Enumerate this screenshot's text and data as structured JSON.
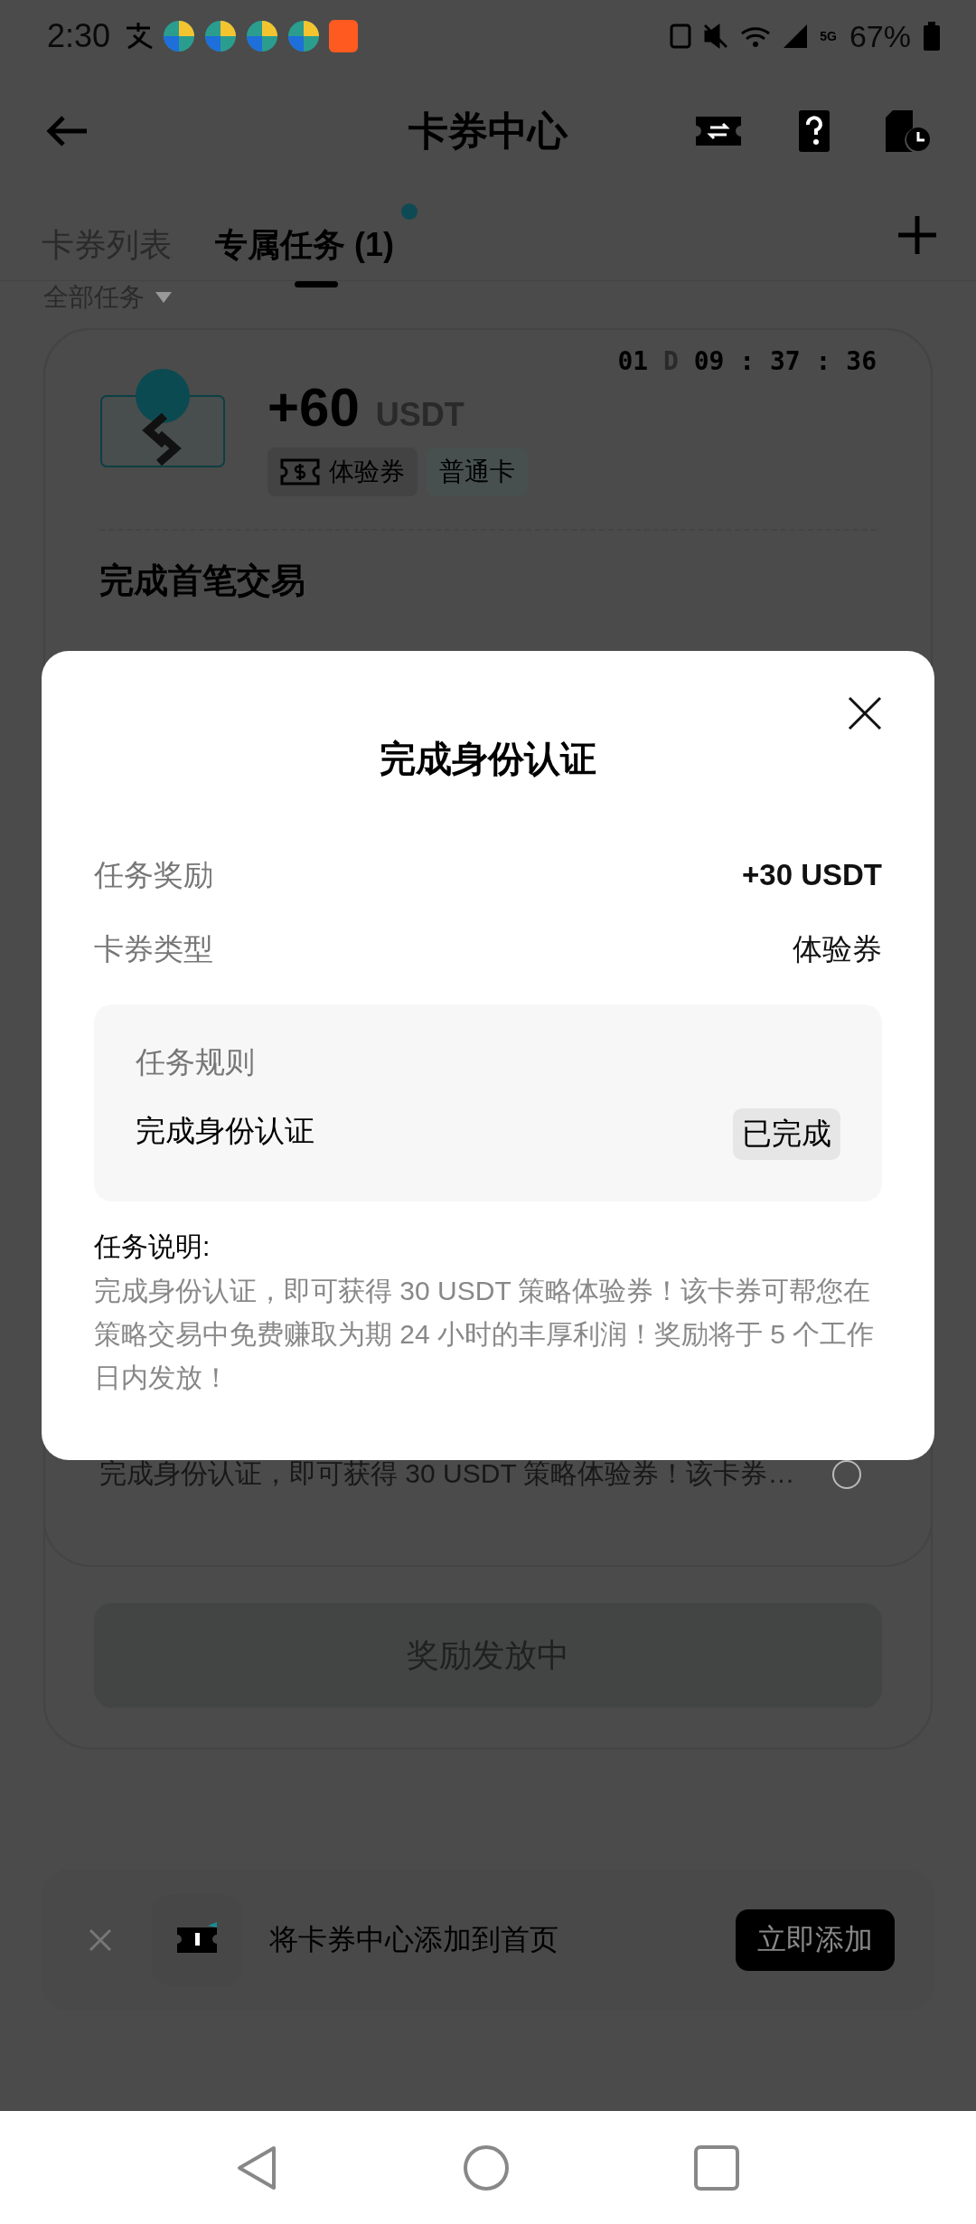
{
  "status_bar": {
    "time": "2:30",
    "network": "5G",
    "battery": "67%"
  },
  "header": {
    "title": "卡券中心"
  },
  "tabs": [
    {
      "label": "卡券列表",
      "selected": false,
      "dot": false
    },
    {
      "label": "专属任务 (1)",
      "selected": true,
      "dot": true
    }
  ],
  "filter": {
    "label": "全部任务"
  },
  "task_card": {
    "countdown": {
      "days": "01",
      "day_unit": "D",
      "time": "09 : 37 : 36"
    },
    "amount": "+60",
    "currency": "USDT",
    "tags": [
      {
        "label": "体验券",
        "kind": "voucher"
      },
      {
        "label": "普通卡",
        "kind": "plain"
      }
    ],
    "title": "完成首笔交易",
    "description": "完成身份认证，即可获得 30 USDT 策略体验券！该卡券…",
    "button": {
      "label": "奖励发放中",
      "disabled": true
    }
  },
  "banner": {
    "text": "将卡券中心添加到首页",
    "button": "立即添加"
  },
  "modal": {
    "title": "完成身份认证",
    "rows": [
      {
        "label": "任务奖励",
        "value": "+30 USDT",
        "kind": "strong"
      },
      {
        "label": "卡券类型",
        "value": "体验券",
        "kind": "plain"
      }
    ],
    "rules": {
      "heading": "任务规则",
      "items": [
        {
          "label": "完成身份认证",
          "status": "已完成"
        }
      ]
    },
    "description": {
      "heading": "任务说明:",
      "text": "完成身份认证，即可获得 30 USDT 策略体验券！该卡券可帮您在策略交易中免费赚取为期 24 小时的丰厚利润！奖励将于 5 个工作日内发放！"
    }
  }
}
